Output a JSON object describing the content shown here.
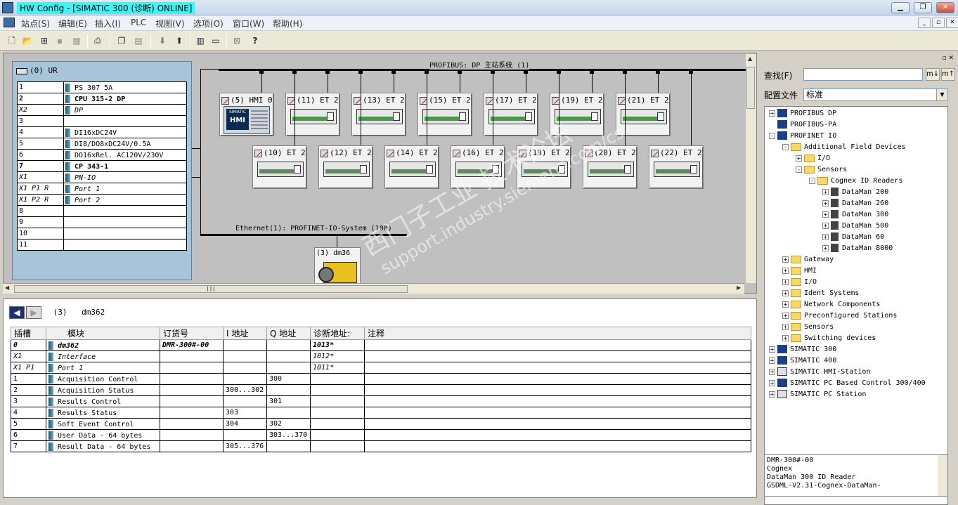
{
  "titlebar": {
    "title": "HW Config - [SIMATIC 300 (诊断)  ONLINE]",
    "btn_min": "▁",
    "btn_max": "❐",
    "btn_close": "✕"
  },
  "menu": {
    "items": [
      "站点(S)",
      "编辑(E)",
      "插入(I)",
      "PLC",
      "视图(V)",
      "选项(O)",
      "窗口(W)",
      "帮助(H)"
    ],
    "mdi_min": "_",
    "mdi_restore": "▫",
    "mdi_close": "✕"
  },
  "rack": {
    "title": "(0) UR",
    "rows": [
      {
        "slot": "1",
        "name": "PS 307 5A",
        "bold": false,
        "italic": false,
        "icon": true
      },
      {
        "slot": "2",
        "name": "CPU 315-2 DP",
        "bold": true,
        "italic": false,
        "icon": true
      },
      {
        "slot": "X2",
        "name": "DP",
        "bold": false,
        "italic": true,
        "icon": true
      },
      {
        "slot": "3",
        "name": "",
        "bold": false,
        "italic": false,
        "icon": false
      },
      {
        "slot": "4",
        "name": "DI16xDC24V",
        "bold": false,
        "italic": false,
        "icon": true
      },
      {
        "slot": "5",
        "name": "DI8/DO8xDC24V/0.5A",
        "bold": false,
        "italic": false,
        "icon": true
      },
      {
        "slot": "6",
        "name": "DO16xRel. AC120V/230V",
        "bold": false,
        "italic": false,
        "icon": true
      },
      {
        "slot": "7",
        "name": "CP 343-1",
        "bold": true,
        "italic": false,
        "icon": true
      },
      {
        "slot": "X1",
        "name": "PN-IO",
        "bold": false,
        "italic": true,
        "icon": true
      },
      {
        "slot": "X1 P1 R",
        "name": "Port 1",
        "bold": false,
        "italic": true,
        "icon": true
      },
      {
        "slot": "X1 P2 R",
        "name": "Port 2",
        "bold": false,
        "italic": true,
        "icon": true
      },
      {
        "slot": "8",
        "name": "",
        "bold": false,
        "italic": false,
        "icon": false
      },
      {
        "slot": "9",
        "name": "",
        "bold": false,
        "italic": false,
        "icon": false
      },
      {
        "slot": "10",
        "name": "",
        "bold": false,
        "italic": false,
        "icon": false
      },
      {
        "slot": "11",
        "name": "",
        "bold": false,
        "italic": false,
        "icon": false
      }
    ]
  },
  "network": {
    "profibus_label": "PROFIBUS: DP 主站系统 (1)",
    "ethernet_label": "Ethernet(1): PROFINET-IO-System (100)",
    "hmi": {
      "label": "(5) HMI 0",
      "screen_brand": "SIMATIC",
      "screen_text": "HMI"
    },
    "top_devices": [
      "(11) ET 2",
      "(13) ET 2",
      "(15) ET 2",
      "(17) ET 2",
      "(19) ET 2",
      "(21) ET 2"
    ],
    "bottom_devices": [
      "(10) ET 2",
      "(12) ET 2",
      "(14) ET 2",
      "(16) ET 2",
      "(18) ET 2",
      "(20) ET 2",
      "(22) ET 2"
    ],
    "camera_label": "(3)  dm36"
  },
  "detail": {
    "nav_label": "(3)",
    "nav_name": "dm362",
    "headers": [
      "插槽",
      "模块",
      "订货号",
      "I 地址",
      "Q 地址",
      "诊断地址:",
      "注释"
    ],
    "rows": [
      {
        "slot": "0",
        "module": "dm362",
        "order": "DMR-300#-00",
        "i": "",
        "q": "",
        "diag": "1013*",
        "comment": "",
        "style": "bold"
      },
      {
        "slot": "X1",
        "module": "Interface",
        "order": "",
        "i": "",
        "q": "",
        "diag": "1012*",
        "comment": "",
        "style": "italic"
      },
      {
        "slot": "X1 P1",
        "module": "Port 1",
        "order": "",
        "i": "",
        "q": "",
        "diag": "1011*",
        "comment": "",
        "style": "italic"
      },
      {
        "slot": "1",
        "module": "Acquisition Control",
        "order": "",
        "i": "",
        "q": "300",
        "diag": "",
        "comment": "",
        "style": "normal"
      },
      {
        "slot": "2",
        "module": "Acquisition Status",
        "order": "",
        "i": "300...302",
        "q": "",
        "diag": "",
        "comment": "",
        "style": "normal"
      },
      {
        "slot": "3",
        "module": "Results Control",
        "order": "",
        "i": "",
        "q": "301",
        "diag": "",
        "comment": "",
        "style": "normal"
      },
      {
        "slot": "4",
        "module": "Results Status",
        "order": "",
        "i": "303",
        "q": "",
        "diag": "",
        "comment": "",
        "style": "normal"
      },
      {
        "slot": "5",
        "module": "Soft Event Control",
        "order": "",
        "i": "304",
        "q": "302",
        "diag": "",
        "comment": "",
        "style": "normal"
      },
      {
        "slot": "6",
        "module": "User Data - 64 bytes",
        "order": "",
        "i": "",
        "q": "303...370",
        "diag": "",
        "comment": "",
        "style": "normal"
      },
      {
        "slot": "7",
        "module": "Result Data - 64 bytes",
        "order": "",
        "i": "305...376",
        "q": "",
        "diag": "",
        "comment": "",
        "style": "normal"
      }
    ]
  },
  "catalog": {
    "search_label": "查找(F)",
    "search_value": "",
    "profile_label": "配置文件",
    "profile_value": "标准",
    "tree": [
      {
        "label": "PROFIBUS DP",
        "level": 0,
        "pm": "+",
        "icon": "cat"
      },
      {
        "label": "PROFIBUS-PA",
        "level": 0,
        "pm": "",
        "icon": "cat"
      },
      {
        "label": "PROFINET IO",
        "level": 0,
        "pm": "-",
        "icon": "cat"
      },
      {
        "label": "Additional Field Devices",
        "level": 1,
        "pm": "-",
        "icon": "fold"
      },
      {
        "label": "I/O",
        "level": 2,
        "pm": "+",
        "icon": "fold"
      },
      {
        "label": "Sensors",
        "level": 2,
        "pm": "-",
        "icon": "fold"
      },
      {
        "label": "Cognex ID Readers",
        "level": 3,
        "pm": "-",
        "icon": "fold"
      },
      {
        "label": "DataMan 200",
        "level": 4,
        "pm": "+",
        "icon": "cam"
      },
      {
        "label": "DataMan 260",
        "level": 4,
        "pm": "+",
        "icon": "cam"
      },
      {
        "label": "DataMan 300",
        "level": 4,
        "pm": "+",
        "icon": "cam"
      },
      {
        "label": "DataMan 500",
        "level": 4,
        "pm": "+",
        "icon": "cam"
      },
      {
        "label": "DataMan 60",
        "level": 4,
        "pm": "+",
        "icon": "cam"
      },
      {
        "label": "DataMan 8000",
        "level": 4,
        "pm": "+",
        "icon": "cam"
      },
      {
        "label": "Gateway",
        "level": 1,
        "pm": "+",
        "icon": "fold"
      },
      {
        "label": "HMI",
        "level": 1,
        "pm": "+",
        "icon": "fold"
      },
      {
        "label": "I/O",
        "level": 1,
        "pm": "+",
        "icon": "fold"
      },
      {
        "label": "Ident Systems",
        "level": 1,
        "pm": "+",
        "icon": "fold"
      },
      {
        "label": "Network Components",
        "level": 1,
        "pm": "+",
        "icon": "fold"
      },
      {
        "label": "Preconfigured Stations",
        "level": 1,
        "pm": "+",
        "icon": "fold"
      },
      {
        "label": "Sensors",
        "level": 1,
        "pm": "+",
        "icon": "fold"
      },
      {
        "label": "Switching devices",
        "level": 1,
        "pm": "+",
        "icon": "fold"
      },
      {
        "label": "SIMATIC 300",
        "level": 0,
        "pm": "+",
        "icon": "cat"
      },
      {
        "label": "SIMATIC 400",
        "level": 0,
        "pm": "+",
        "icon": "cat"
      },
      {
        "label": "SIMATIC HMI-Station",
        "level": 0,
        "pm": "+",
        "icon": "mon"
      },
      {
        "label": "SIMATIC PC Based Control 300/400",
        "level": 0,
        "pm": "+",
        "icon": "cat"
      },
      {
        "label": "SIMATIC PC Station",
        "level": 0,
        "pm": "+",
        "icon": "mon"
      }
    ],
    "info_lines": [
      "DMR-300#-00",
      "Cognex",
      "DataMan 300 ID Reader",
      "GSDML-V2.31-Cognex-DataMan-"
    ]
  },
  "watermark": {
    "main": "西门子工业  技术论坛",
    "sub": "support.industry.siemens.com/cs"
  }
}
